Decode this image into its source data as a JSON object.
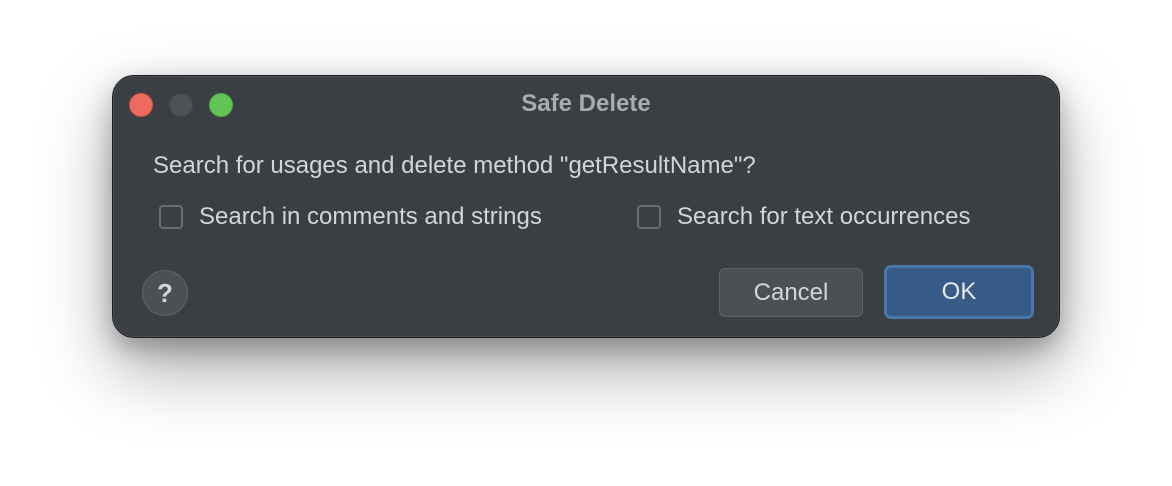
{
  "window": {
    "title": "Safe Delete"
  },
  "message": "Search for usages and delete method \"getResultName\"?",
  "options": [
    {
      "label": "Search in comments and strings",
      "checked": false
    },
    {
      "label": "Search for text occurrences",
      "checked": false
    }
  ],
  "help": {
    "label": "?"
  },
  "buttons": {
    "cancel": "Cancel",
    "ok": "OK"
  },
  "colors": {
    "dialog_bg": "#3b3e42",
    "primary_button": "#375a86",
    "close": "#ec6a5e",
    "minimize": "#4e5156",
    "maximize": "#61c454"
  },
  "icons": [
    "close-traffic-light-icon",
    "minimize-traffic-light-icon",
    "maximize-traffic-light-icon",
    "help-icon"
  ]
}
